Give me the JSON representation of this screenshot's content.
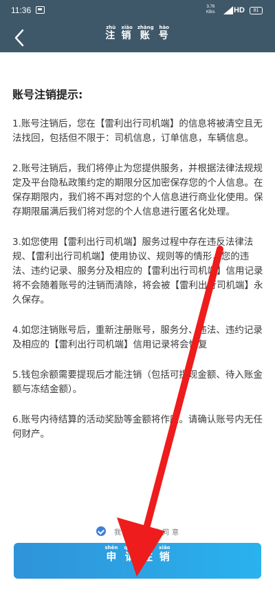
{
  "status_bar": {
    "time": "11:36",
    "network_speed": "3.76",
    "network_speed_unit": "KB/s",
    "network_type": "HD",
    "battery": "81"
  },
  "nav": {
    "title_chars": [
      {
        "char": "注",
        "pinyin": "zhù"
      },
      {
        "char": "销",
        "pinyin": "xiāo"
      },
      {
        "char": "账",
        "pinyin": "zhàng"
      },
      {
        "char": "号",
        "pinyin": "hào"
      }
    ]
  },
  "notice": {
    "heading": "账号注销提示:",
    "items": [
      "1.账号注销后，您在【雷利出行司机端】的信息将被清空且无法找回，包括但不限于：司机信息，订单信息，车辆信息。",
      "2.账号注销后，我们将停止为您提供服务，并根据法律法规规定及平台隐私政策约定的期限分区加密保存您的个人信息。在保存期限内，我们将不再对您的个人信息进行商业化使用。保存期限届满后我们将对您的个人信息进行匿名化处理。",
      "3.如您使用【雷利出行司机端】服务过程中存在违反法律法规、【雷利出行司机端】使用协议、规则等的情形，您的违法、违约记录、服务分及相应的【雷利出行司机端】信用记录将不会随着账号的注销而清除，将会被【雷利出行司机端】永久保存。",
      "4.如您注销账号后，重新注册账号，服务分、违法、违约记录及相应的【雷利出行司机端】信用记录将会恢复",
      "5.钱包余额需要提现后才能注销（包括可提现金额、待入账金额与冻结金额）。",
      "6.账号内待结算的活动奖励等金额将作废。请确认账号内无任何财产。"
    ]
  },
  "agreement": {
    "checked": true,
    "text": "我已阅读并同意"
  },
  "apply_button": {
    "chars": [
      {
        "char": "申",
        "pinyin": "shēn"
      },
      {
        "char": "请",
        "pinyin": "qǐng"
      },
      {
        "char": "注",
        "pinyin": "zhù"
      },
      {
        "char": "销",
        "pinyin": "xiāo"
      }
    ]
  },
  "colors": {
    "header_bg": "#3f5869",
    "button_gradient_start": "#2f93d8",
    "button_gradient_end": "#2ab2ee",
    "check_blue": "#3f7fd6",
    "arrow_red": "#ee1c1c"
  }
}
